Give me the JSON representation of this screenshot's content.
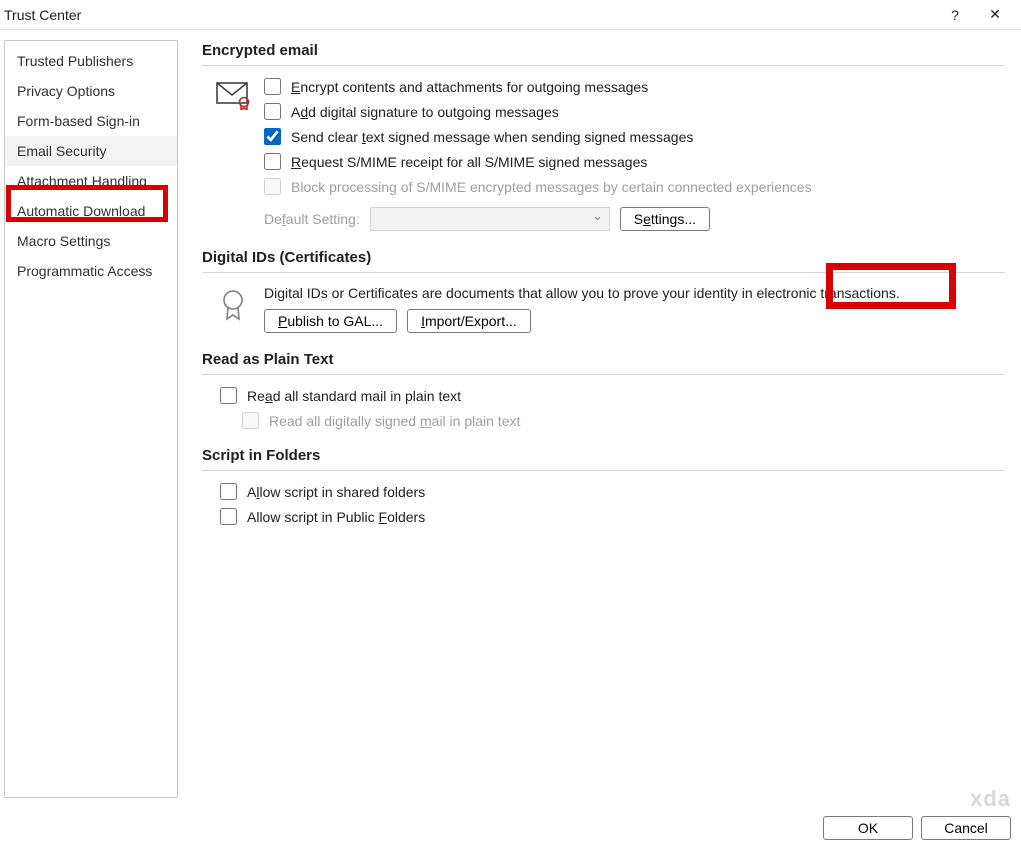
{
  "window": {
    "title": "Trust Center",
    "help": "?",
    "close": "✕"
  },
  "sidebar": {
    "items": [
      {
        "label": "Trusted Publishers"
      },
      {
        "label": "Privacy Options"
      },
      {
        "label": "Form-based Sign-in"
      },
      {
        "label": "Email Security",
        "selected": true,
        "highlighted": true
      },
      {
        "label": "Attachment Handling"
      },
      {
        "label": "Automatic Download"
      },
      {
        "label": "Macro Settings"
      },
      {
        "label": "Programmatic Access"
      }
    ]
  },
  "encrypted": {
    "heading": "Encrypted email",
    "encrypt_pre": "E",
    "encrypt_post": "ncrypt contents and attachments for outgoing messages",
    "addsig_pre": "A",
    "addsig_mid": "d",
    "addsig_post": "d digital signature to outgoing messages",
    "cleartext_pre": "Send clear ",
    "cleartext_u": "t",
    "cleartext_post": "ext signed message when sending signed messages",
    "request_pre": "R",
    "request_post": "equest S/MIME receipt for all S/MIME signed messages",
    "block_text": "Block processing of S/MIME encrypted messages by certain connected experiences",
    "default_pre": "De",
    "default_u": "f",
    "default_post": "ault Setting:",
    "settings_pre": "S",
    "settings_u": "e",
    "settings_post": "ttings..."
  },
  "digital": {
    "heading": "Digital IDs (Certificates)",
    "desc": "Digital IDs or Certificates are documents that allow you to prove your identity in electronic transactions.",
    "publish_pre": "P",
    "publish_post": "ublish to GAL...",
    "import_pre": "I",
    "import_post": "mport/Export..."
  },
  "readplain": {
    "heading": "Read as Plain Text",
    "read_pre": "Re",
    "read_u": "a",
    "read_post": "d all standard mail in plain text",
    "readsig_pre": "Read all digitally signed ",
    "readsig_u": "m",
    "readsig_post": "ail in plain text"
  },
  "script": {
    "heading": "Script in Folders",
    "shared_pre": "A",
    "shared_u": "l",
    "shared_post": "low script in shared folders",
    "public_pre": "Allow script in Public ",
    "public_u": "F",
    "public_post": "olders"
  },
  "footer": {
    "ok": "OK",
    "cancel": "Cancel"
  },
  "watermark": "xda"
}
